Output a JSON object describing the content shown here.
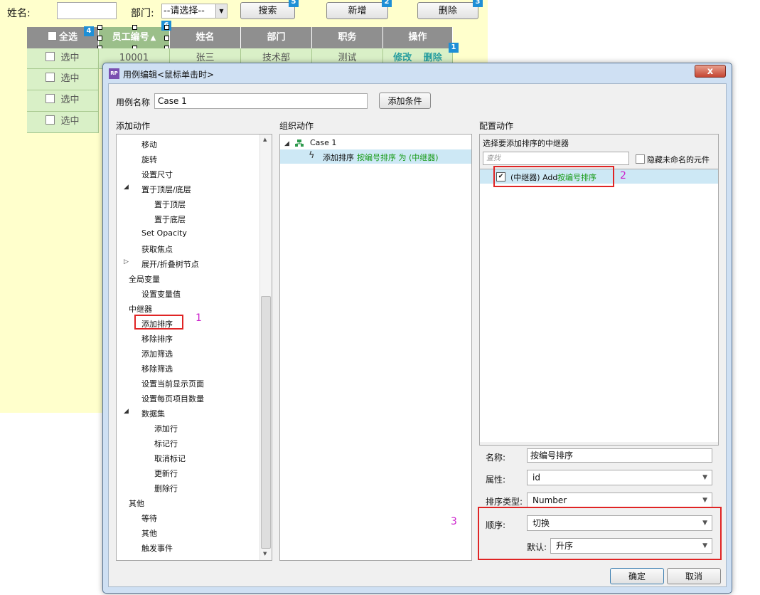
{
  "background_page": {
    "name_label": "姓名:",
    "dept_label": "部门:",
    "dept_select": "--请选择--",
    "search_button": "搜索",
    "add_button": "新增",
    "delete_button": "删除",
    "badges": [
      "1",
      "2",
      "3",
      "4",
      "5",
      "6"
    ],
    "table": {
      "headers": [
        "全选",
        "员工编号",
        "姓名",
        "部门",
        "职务",
        "操作"
      ],
      "first_row": {
        "select": "选中",
        "id": "10001",
        "name": "张三",
        "dept": "技术部",
        "job": "测试",
        "edit": "修改",
        "delete": "删除"
      },
      "other_rows_select": [
        "选中",
        "选中",
        "选中"
      ]
    }
  },
  "dialog": {
    "app_icon": "RP",
    "title": "用例编辑<鼠标单击时>",
    "close": "x",
    "case_name_label": "用例名称",
    "case_name_value": "Case 1",
    "add_condition_button": "添加条件",
    "add_action_title": "添加动作",
    "organize_title": "组织动作",
    "configure_title": "配置动作",
    "action_tree": [
      {
        "label": "移动",
        "level": 1
      },
      {
        "label": "旋转",
        "level": 1
      },
      {
        "label": "设置尺寸",
        "level": 1
      },
      {
        "label": "置于顶层/底层",
        "level": 1,
        "toggle": "expanded"
      },
      {
        "label": "置于顶层",
        "level": 2
      },
      {
        "label": "置于底层",
        "level": 2
      },
      {
        "label": "Set Opacity",
        "level": 1
      },
      {
        "label": "获取焦点",
        "level": 1
      },
      {
        "label": "展开/折叠树节点",
        "level": 1,
        "toggle": "collapsed"
      },
      {
        "label": "全局变量",
        "level": 0,
        "toggle": "expanded"
      },
      {
        "label": "设置变量值",
        "level": 1
      },
      {
        "label": "中继器",
        "level": 0,
        "toggle": "expanded"
      },
      {
        "label": "添加排序",
        "level": 1
      },
      {
        "label": "移除排序",
        "level": 1
      },
      {
        "label": "添加筛选",
        "level": 1
      },
      {
        "label": "移除筛选",
        "level": 1
      },
      {
        "label": "设置当前显示页面",
        "level": 1
      },
      {
        "label": "设置每页项目数量",
        "level": 1
      },
      {
        "label": "数据集",
        "level": 1,
        "toggle": "expanded"
      },
      {
        "label": "添加行",
        "level": 2
      },
      {
        "label": "标记行",
        "level": 2
      },
      {
        "label": "取消标记",
        "level": 2
      },
      {
        "label": "更新行",
        "level": 2
      },
      {
        "label": "删除行",
        "level": 2
      },
      {
        "label": "其他",
        "level": 0,
        "toggle": "expanded"
      },
      {
        "label": "等待",
        "level": 1
      },
      {
        "label": "其他",
        "level": 1
      },
      {
        "label": "触发事件",
        "level": 1
      }
    ],
    "organize": {
      "case_label": "Case 1",
      "action_prefix": "添加排序",
      "action_detail": "按编号排序 为 (中继器)"
    },
    "configure": {
      "select_repeater_label": "选择要添加排序的中继器",
      "search_placeholder": "查找",
      "hide_unnamed_label": "隐藏未命名的元件",
      "repeater_item_prefix": "(中继器) Add",
      "repeater_item_sort": "按编号排序",
      "name_label": "名称:",
      "name_value": "按编号排序",
      "property_label": "属性:",
      "property_value": "id",
      "sort_type_label": "排序类型:",
      "sort_type_value": "Number",
      "order_label": "顺序:",
      "order_value": "切换",
      "default_label": "默认:",
      "default_value": "升序"
    },
    "ok_button": "确定",
    "cancel_button": "取消"
  },
  "annotations": [
    "1",
    "2",
    "3"
  ],
  "colors": {
    "repeater_badge": "#1e8fd6",
    "highlight_red": "#e02424",
    "annotation_number": "#cc22cc",
    "green_text": "#1a9c1a"
  }
}
